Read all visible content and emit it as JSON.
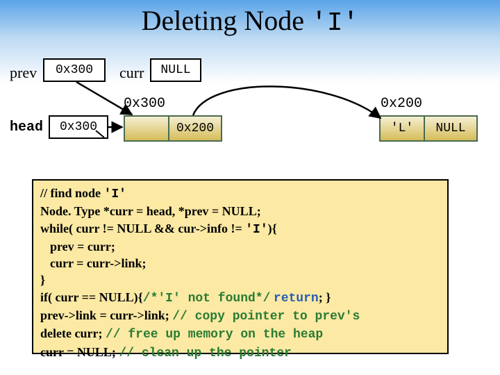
{
  "title": {
    "text": "Deleting Node ",
    "code_literal": "'I'"
  },
  "prev": {
    "label": "prev",
    "value": "0x300"
  },
  "curr": {
    "label": "curr",
    "value": "NULL"
  },
  "addr_left": "0x300",
  "addr_right": "0x200",
  "head": {
    "label": "head",
    "value": "0x300"
  },
  "node1": {
    "link": "0x200"
  },
  "node2": {
    "info": "'L'",
    "link": "NULL"
  },
  "code": {
    "c1_a": "// find node ",
    "c1_code": "'I'",
    "c2_a": "Node. Type *curr = head, *prev = NULL;",
    "c3_a": "while( curr != NULL  &&  cur->info != ",
    "c3_code": "'I'",
    "c3_b": "){",
    "c4": "prev = curr;",
    "c5": "curr = curr->link;",
    "c6": "}",
    "c7_a": "if( curr == NULL){",
    "c7_cmt": "/*'I' not found*/",
    "c7_b": " ",
    "c7_ret": "return",
    "c7_c": "; }",
    "c8_a": "prev->link = curr->link; ",
    "c8_cmt": "// copy pointer to prev's",
    "c9_a": "delete curr; ",
    "c9_cmt": "// free up memory on the heap",
    "c10_a": "curr = NULL; ",
    "c10_cmt": "// clean up the pointer"
  }
}
